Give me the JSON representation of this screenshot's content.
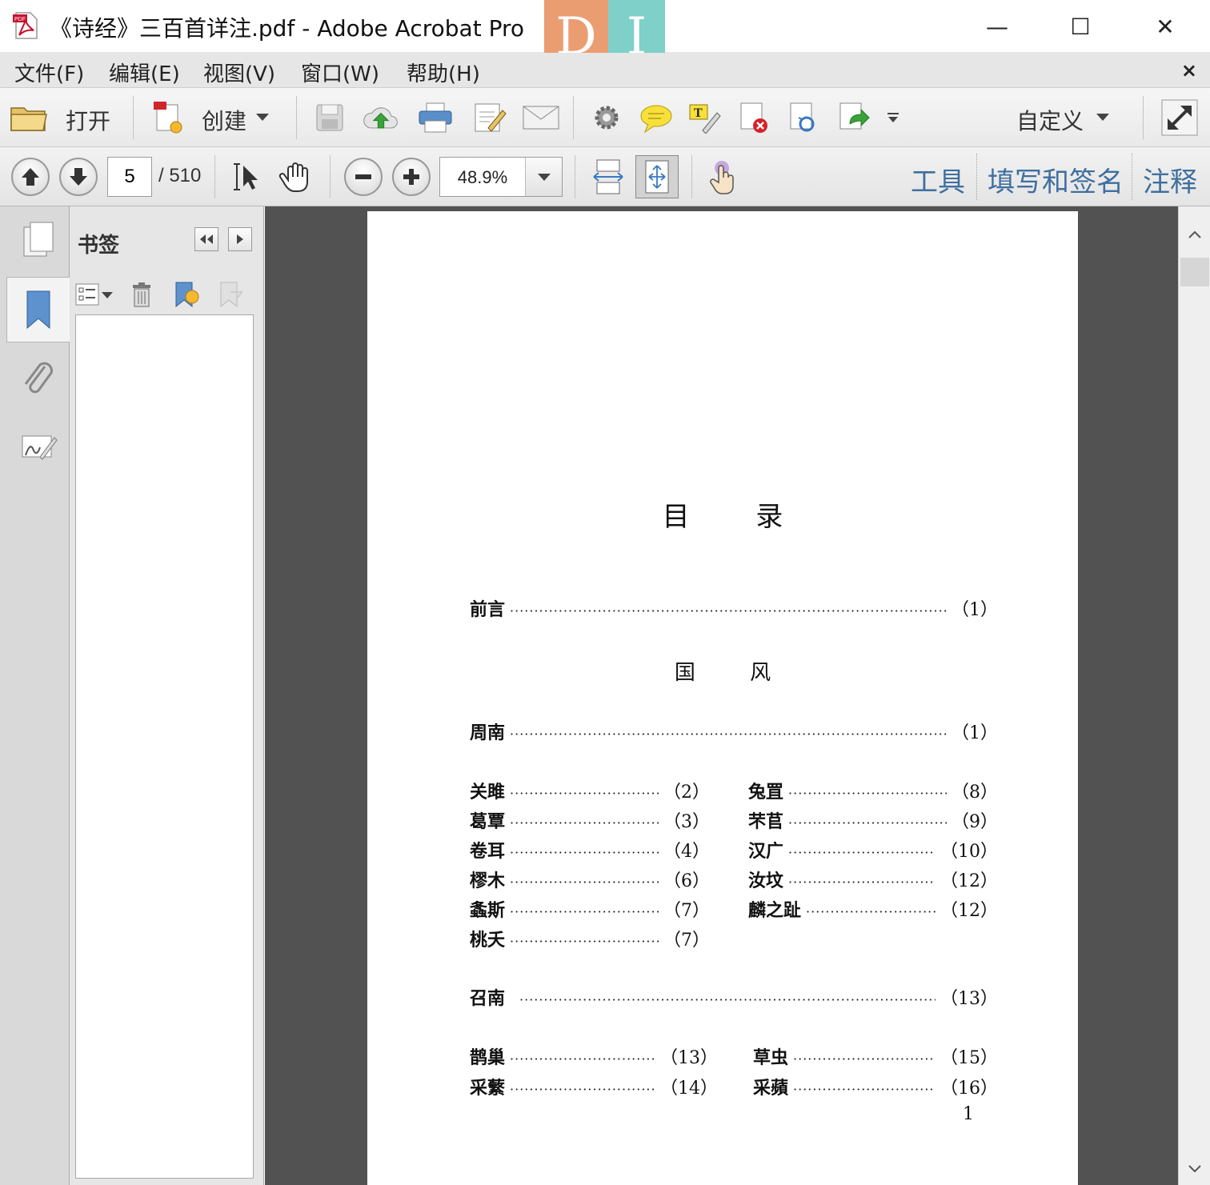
{
  "window": {
    "title": "《诗经》三百首详注.pdf - Adobe Acrobat Pro",
    "logo_left": "D",
    "logo_right": "I",
    "minimize": "—",
    "maximize": "☐",
    "close": "✕"
  },
  "menu": {
    "items": [
      "文件(F)",
      "编辑(E)",
      "视图(V)",
      "窗口(W)",
      "帮助(H)"
    ],
    "close": "×"
  },
  "toolbar": {
    "open_label": "打开",
    "create_label": "创建",
    "customize_label": "自定义",
    "icons": [
      "folder-open-icon",
      "create-pdf-icon",
      "save-icon",
      "cloud-upload-icon",
      "print-icon",
      "edit-icon",
      "email-icon",
      "settings-icon",
      "comment-icon",
      "highlight-text-icon",
      "delete-pages-icon",
      "extract-icon",
      "export-icon",
      "more-icon",
      "fullscreen-icon"
    ]
  },
  "navigation": {
    "current_page": "5",
    "total_pages": "/ 510",
    "zoom": "48.9%",
    "panes": [
      "工具",
      "填写和签名",
      "注释"
    ]
  },
  "bookmarks": {
    "title": "书签"
  },
  "document": {
    "toc_title": "目  录",
    "preface": {
      "title": "前言",
      "page": "（1）"
    },
    "section_title": "国  风",
    "zhounan": {
      "title": "周南",
      "page": "（1）"
    },
    "zhounan_left": [
      {
        "title": "关雎",
        "page": "（2）"
      },
      {
        "title": "葛覃",
        "page": "（3）"
      },
      {
        "title": "卷耳",
        "page": "（4）"
      },
      {
        "title": "樛木",
        "page": "（6）"
      },
      {
        "title": "螽斯",
        "page": "（7）"
      },
      {
        "title": "桃夭",
        "page": "（7）"
      }
    ],
    "zhounan_right": [
      {
        "title": "兔罝",
        "page": "（8）"
      },
      {
        "title": "芣苢",
        "page": "（9）"
      },
      {
        "title": "汉广",
        "page": "（10）"
      },
      {
        "title": "汝坟",
        "page": "（12）"
      },
      {
        "title": "麟之趾",
        "page": "（12）"
      }
    ],
    "shaonan": {
      "title": "召南",
      "page": "（13）"
    },
    "shaonan_left": [
      {
        "title": "鹊巢",
        "page": "（13）"
      },
      {
        "title": "采蘩",
        "page": "（14）"
      }
    ],
    "shaonan_right": [
      {
        "title": "草虫",
        "page": "（15）"
      },
      {
        "title": "采蘋",
        "page": "（16）"
      }
    ],
    "page_number": "1"
  },
  "colors": {
    "pane_link": "#3f6f9f",
    "doc_background": "#525252",
    "logo_orange": "#eb9d72",
    "logo_teal": "#7fd0c8"
  }
}
